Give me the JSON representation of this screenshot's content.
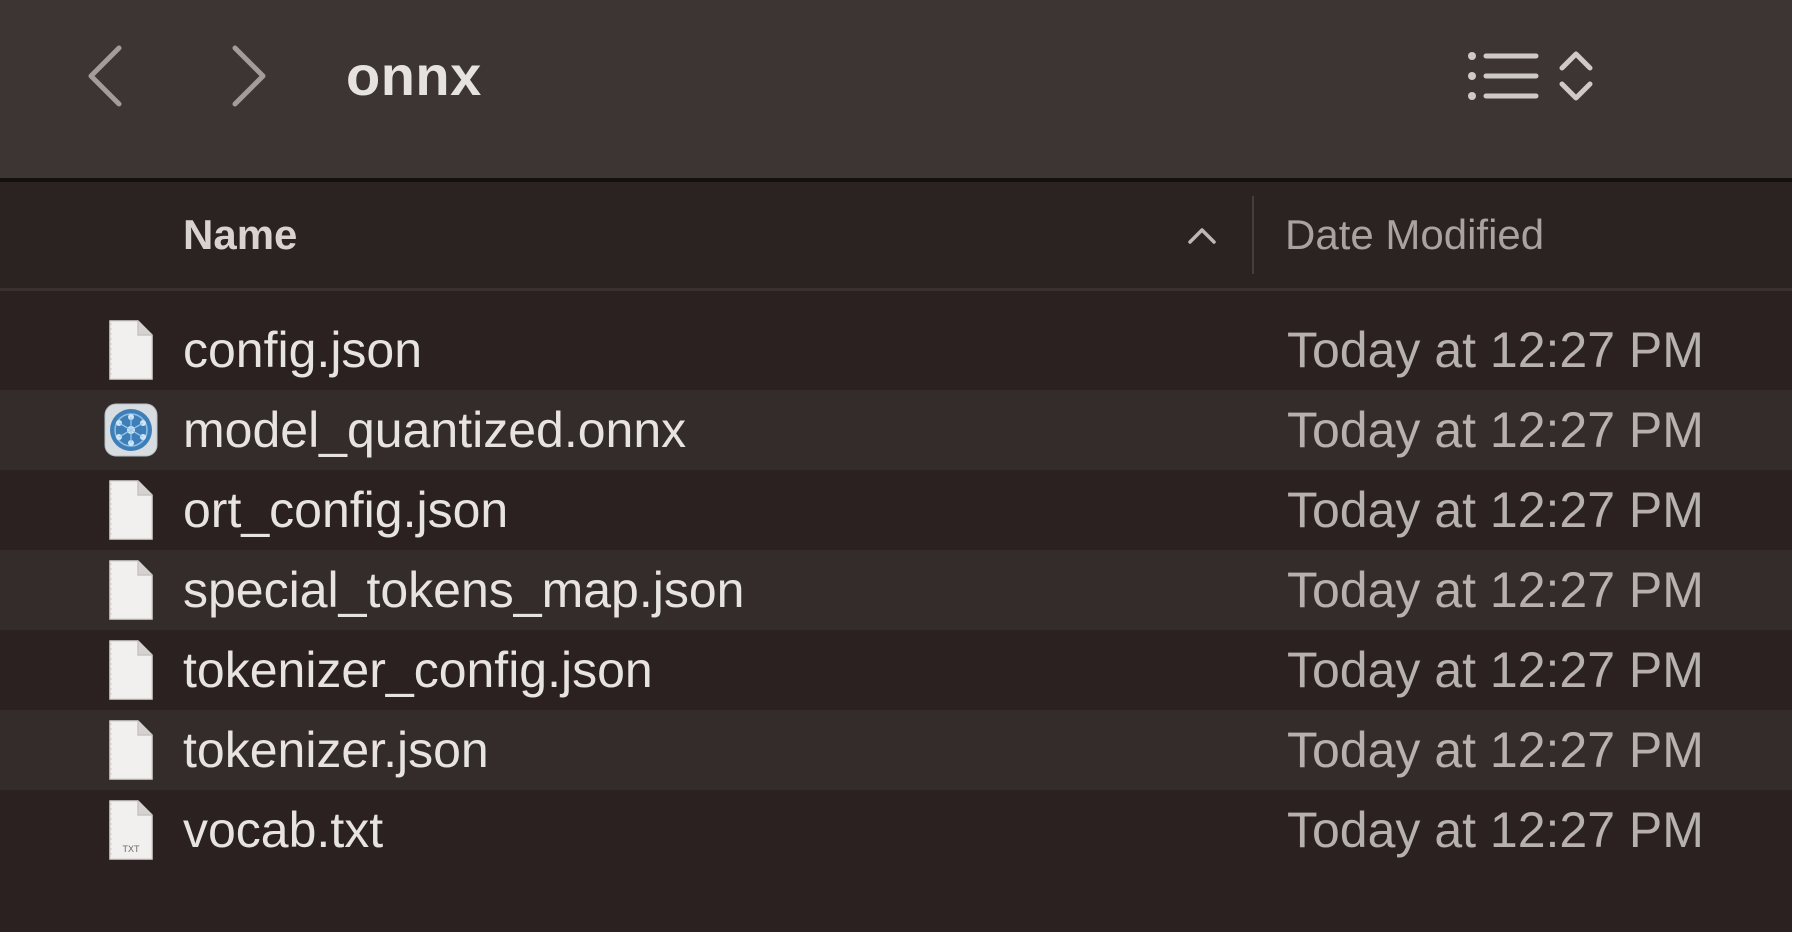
{
  "window": {
    "title": "onnx"
  },
  "toolbar": {
    "back_icon": "chevron-left-icon",
    "forward_icon": "chevron-right-icon",
    "view_icon": "list-view-icon",
    "view_menu_icon": "chevron-up-down-icon"
  },
  "columns": {
    "name_label": "Name",
    "date_label": "Date Modified",
    "sort_direction": "ascending",
    "sort_icon": "chevron-up-icon"
  },
  "files": [
    {
      "name": "config.json",
      "date": "Today at 12:27 PM",
      "icon": "document-icon"
    },
    {
      "name": "model_quantized.onnx",
      "date": "Today at 12:27 PM",
      "icon": "onnx-model-icon"
    },
    {
      "name": "ort_config.json",
      "date": "Today at 12:27 PM",
      "icon": "document-icon"
    },
    {
      "name": "special_tokens_map.json",
      "date": "Today at 12:27 PM",
      "icon": "document-icon"
    },
    {
      "name": "tokenizer_config.json",
      "date": "Today at 12:27 PM",
      "icon": "document-icon"
    },
    {
      "name": "tokenizer.json",
      "date": "Today at 12:27 PM",
      "icon": "document-icon"
    },
    {
      "name": "vocab.txt",
      "date": "Today at 12:27 PM",
      "icon": "text-file-icon",
      "icon_label": "TXT"
    }
  ],
  "colors": {
    "background": "#2a2120",
    "toolbar": "#3d3533",
    "row_alt": "#342c2b",
    "text_primary": "#e7e3e1",
    "text_secondary": "#b6b0ae"
  }
}
